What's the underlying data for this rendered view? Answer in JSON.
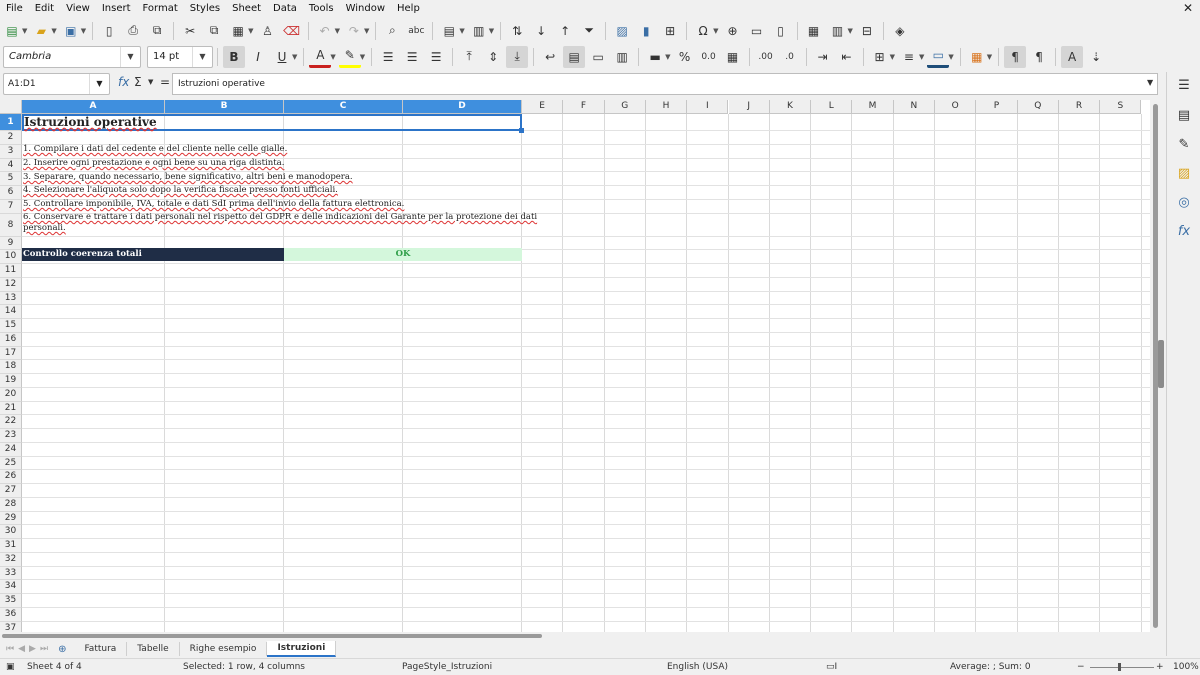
{
  "menu": [
    "File",
    "Edit",
    "View",
    "Insert",
    "Format",
    "Styles",
    "Sheet",
    "Data",
    "Tools",
    "Window",
    "Help"
  ],
  "window_close": "✕",
  "toolbar": {
    "font_name": "Cambria",
    "font_size": "14 pt",
    "bold_label": "B",
    "italic_label": "I",
    "underline_label": "U",
    "font_color_label": "A",
    "percent_label": "%",
    "number_label": "0.0"
  },
  "formula_bar": {
    "name_box": "A1:D1",
    "function_wizard": "fx",
    "sum_symbol": "Σ",
    "equals": "=",
    "content": "Istruzioni operative"
  },
  "columns": [
    "A",
    "B",
    "C",
    "D",
    "E",
    "F",
    "G",
    "H",
    "I",
    "J",
    "K",
    "L",
    "M",
    "N",
    "O",
    "P",
    "Q",
    "R",
    "S"
  ],
  "selected_columns": [
    "A",
    "B",
    "C",
    "D"
  ],
  "rows": [
    "1",
    "2",
    "3",
    "4",
    "5",
    "6",
    "7",
    "8",
    "9",
    "10",
    "11",
    "12",
    "13",
    "14",
    "15",
    "16",
    "17",
    "18",
    "19",
    "20",
    "21",
    "22",
    "23",
    "24",
    "25",
    "26",
    "27",
    "28",
    "29",
    "30",
    "31",
    "32",
    "33",
    "34",
    "35",
    "36",
    "37"
  ],
  "cells": {
    "title": "Istruzioni operative",
    "instructions": [
      "1. Compilare i dati del cedente e del cliente nelle celle gialle.",
      "2. Inserire ogni prestazione e ogni bene su una riga distinta.",
      "3. Separare, quando necessario, bene significativo, altri beni e manodopera.",
      "4. Selezionare l'aliquota solo dopo la verifica fiscale presso fonti ufficiali.",
      "5. Controllare imponibile, IVA, totale e dati SdI prima dell'invio della fattura elettronica.",
      "6. Conservare e trattare i dati personali nel rispetto del GDPR e delle indicazioni del Garante per la protezione dei dati",
      "personali."
    ],
    "check_label": "Controllo coerenza totali",
    "check_result": "OK"
  },
  "sheet_tabs": [
    "Fattura",
    "Tabelle",
    "Righe esempio",
    "Istruzioni"
  ],
  "active_tab": "Istruzioni",
  "status": {
    "sheet": "Sheet 4 of 4",
    "selection": "Selected: 1 row, 4 columns",
    "page_style": "PageStyle_Istruzioni",
    "language": "English (USA)",
    "summary": "Average: ; Sum: 0",
    "zoom": "100%"
  },
  "colors": {
    "selection": "#3f8fde",
    "header_band": "#1f2d46",
    "ok_fill": "#d4f7dc",
    "ok_text": "#2e9e48"
  }
}
